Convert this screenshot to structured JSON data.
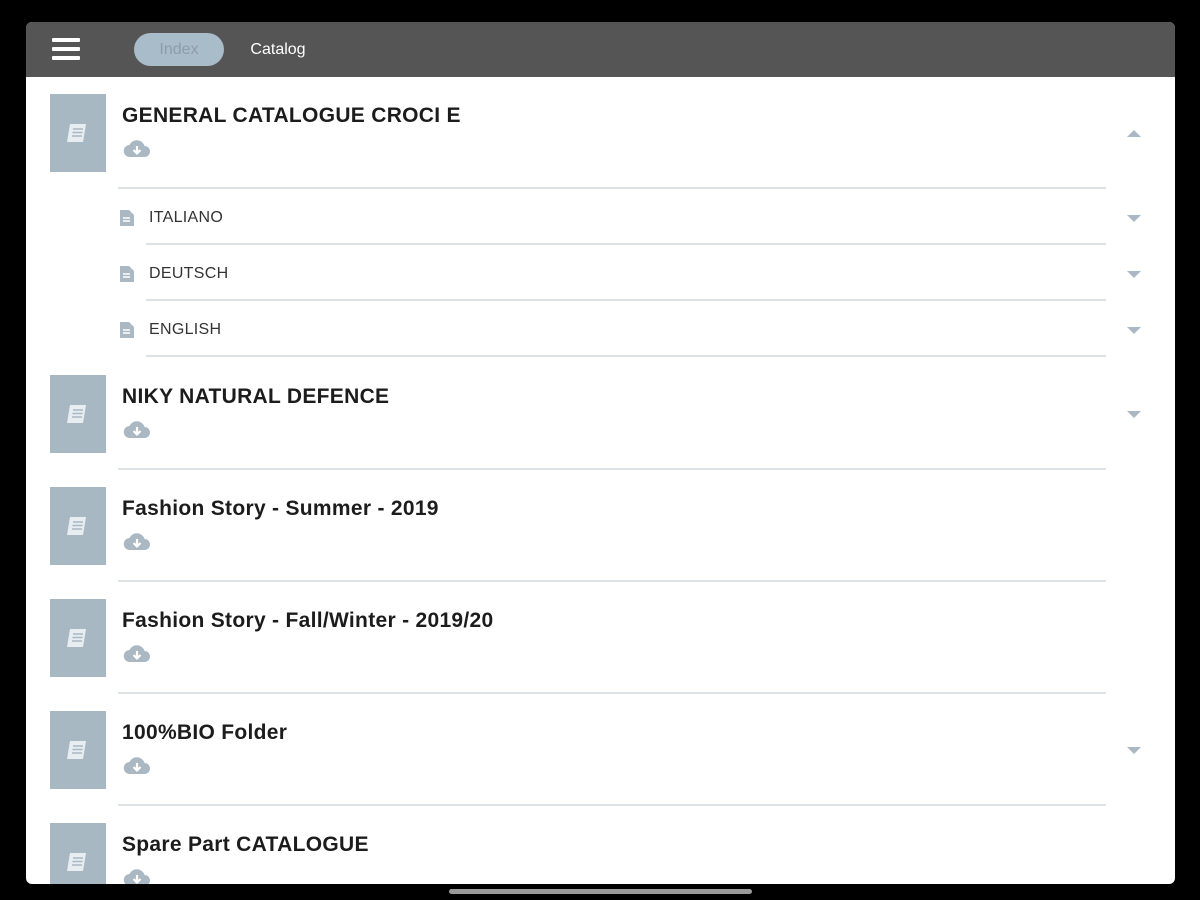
{
  "toolbar": {
    "menu_icon": "hamburger-menu-icon",
    "tabs": [
      {
        "label": "Index",
        "active": true
      },
      {
        "label": "Catalog",
        "active": false
      }
    ]
  },
  "catalogs": [
    {
      "title": "GENERAL CATALOGUE CROCI E",
      "expanded": true,
      "chevron": "chevron-up-icon",
      "languages": [
        "ITALIANO",
        "DEUTSCH",
        "ENGLISH"
      ]
    },
    {
      "title": "NIKY NATURAL DEFENCE",
      "expanded": false,
      "chevron": "chevron-down-icon"
    },
    {
      "title": "Fashion Story - Summer - 2019",
      "expanded": false,
      "chevron": null
    },
    {
      "title": "Fashion Story - Fall/Winter - 2019/20",
      "expanded": false,
      "chevron": null
    },
    {
      "title": "100%BIO Folder",
      "expanded": false,
      "chevron": "chevron-down-icon"
    },
    {
      "title": "Spare Part CATALOGUE",
      "expanded": false,
      "chevron": null
    }
  ],
  "colors": {
    "toolbar": "#555555",
    "active_tab_bg": "#a9bcc9",
    "thumbnail": "#a8b8c3",
    "icon": "#a9b8c3"
  }
}
